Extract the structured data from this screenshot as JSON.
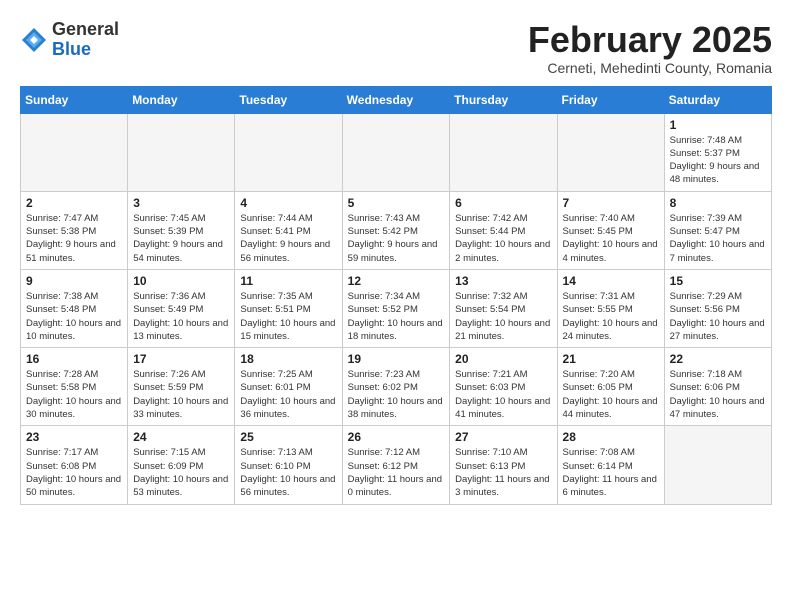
{
  "header": {
    "logo": {
      "general": "General",
      "blue": "Blue"
    },
    "month_title": "February 2025",
    "subtitle": "Cerneti, Mehedinti County, Romania"
  },
  "weekdays": [
    "Sunday",
    "Monday",
    "Tuesday",
    "Wednesday",
    "Thursday",
    "Friday",
    "Saturday"
  ],
  "weeks": [
    {
      "days": [
        {
          "number": "",
          "info": "",
          "empty": true
        },
        {
          "number": "",
          "info": "",
          "empty": true
        },
        {
          "number": "",
          "info": "",
          "empty": true
        },
        {
          "number": "",
          "info": "",
          "empty": true
        },
        {
          "number": "",
          "info": "",
          "empty": true
        },
        {
          "number": "",
          "info": "",
          "empty": true
        },
        {
          "number": "1",
          "info": "Sunrise: 7:48 AM\nSunset: 5:37 PM\nDaylight: 9 hours and 48 minutes.",
          "empty": false
        }
      ]
    },
    {
      "days": [
        {
          "number": "2",
          "info": "Sunrise: 7:47 AM\nSunset: 5:38 PM\nDaylight: 9 hours and 51 minutes.",
          "empty": false
        },
        {
          "number": "3",
          "info": "Sunrise: 7:45 AM\nSunset: 5:39 PM\nDaylight: 9 hours and 54 minutes.",
          "empty": false
        },
        {
          "number": "4",
          "info": "Sunrise: 7:44 AM\nSunset: 5:41 PM\nDaylight: 9 hours and 56 minutes.",
          "empty": false
        },
        {
          "number": "5",
          "info": "Sunrise: 7:43 AM\nSunset: 5:42 PM\nDaylight: 9 hours and 59 minutes.",
          "empty": false
        },
        {
          "number": "6",
          "info": "Sunrise: 7:42 AM\nSunset: 5:44 PM\nDaylight: 10 hours and 2 minutes.",
          "empty": false
        },
        {
          "number": "7",
          "info": "Sunrise: 7:40 AM\nSunset: 5:45 PM\nDaylight: 10 hours and 4 minutes.",
          "empty": false
        },
        {
          "number": "8",
          "info": "Sunrise: 7:39 AM\nSunset: 5:47 PM\nDaylight: 10 hours and 7 minutes.",
          "empty": false
        }
      ]
    },
    {
      "days": [
        {
          "number": "9",
          "info": "Sunrise: 7:38 AM\nSunset: 5:48 PM\nDaylight: 10 hours and 10 minutes.",
          "empty": false
        },
        {
          "number": "10",
          "info": "Sunrise: 7:36 AM\nSunset: 5:49 PM\nDaylight: 10 hours and 13 minutes.",
          "empty": false
        },
        {
          "number": "11",
          "info": "Sunrise: 7:35 AM\nSunset: 5:51 PM\nDaylight: 10 hours and 15 minutes.",
          "empty": false
        },
        {
          "number": "12",
          "info": "Sunrise: 7:34 AM\nSunset: 5:52 PM\nDaylight: 10 hours and 18 minutes.",
          "empty": false
        },
        {
          "number": "13",
          "info": "Sunrise: 7:32 AM\nSunset: 5:54 PM\nDaylight: 10 hours and 21 minutes.",
          "empty": false
        },
        {
          "number": "14",
          "info": "Sunrise: 7:31 AM\nSunset: 5:55 PM\nDaylight: 10 hours and 24 minutes.",
          "empty": false
        },
        {
          "number": "15",
          "info": "Sunrise: 7:29 AM\nSunset: 5:56 PM\nDaylight: 10 hours and 27 minutes.",
          "empty": false
        }
      ]
    },
    {
      "days": [
        {
          "number": "16",
          "info": "Sunrise: 7:28 AM\nSunset: 5:58 PM\nDaylight: 10 hours and 30 minutes.",
          "empty": false
        },
        {
          "number": "17",
          "info": "Sunrise: 7:26 AM\nSunset: 5:59 PM\nDaylight: 10 hours and 33 minutes.",
          "empty": false
        },
        {
          "number": "18",
          "info": "Sunrise: 7:25 AM\nSunset: 6:01 PM\nDaylight: 10 hours and 36 minutes.",
          "empty": false
        },
        {
          "number": "19",
          "info": "Sunrise: 7:23 AM\nSunset: 6:02 PM\nDaylight: 10 hours and 38 minutes.",
          "empty": false
        },
        {
          "number": "20",
          "info": "Sunrise: 7:21 AM\nSunset: 6:03 PM\nDaylight: 10 hours and 41 minutes.",
          "empty": false
        },
        {
          "number": "21",
          "info": "Sunrise: 7:20 AM\nSunset: 6:05 PM\nDaylight: 10 hours and 44 minutes.",
          "empty": false
        },
        {
          "number": "22",
          "info": "Sunrise: 7:18 AM\nSunset: 6:06 PM\nDaylight: 10 hours and 47 minutes.",
          "empty": false
        }
      ]
    },
    {
      "days": [
        {
          "number": "23",
          "info": "Sunrise: 7:17 AM\nSunset: 6:08 PM\nDaylight: 10 hours and 50 minutes.",
          "empty": false
        },
        {
          "number": "24",
          "info": "Sunrise: 7:15 AM\nSunset: 6:09 PM\nDaylight: 10 hours and 53 minutes.",
          "empty": false
        },
        {
          "number": "25",
          "info": "Sunrise: 7:13 AM\nSunset: 6:10 PM\nDaylight: 10 hours and 56 minutes.",
          "empty": false
        },
        {
          "number": "26",
          "info": "Sunrise: 7:12 AM\nSunset: 6:12 PM\nDaylight: 11 hours and 0 minutes.",
          "empty": false
        },
        {
          "number": "27",
          "info": "Sunrise: 7:10 AM\nSunset: 6:13 PM\nDaylight: 11 hours and 3 minutes.",
          "empty": false
        },
        {
          "number": "28",
          "info": "Sunrise: 7:08 AM\nSunset: 6:14 PM\nDaylight: 11 hours and 6 minutes.",
          "empty": false
        },
        {
          "number": "",
          "info": "",
          "empty": true
        }
      ]
    }
  ]
}
